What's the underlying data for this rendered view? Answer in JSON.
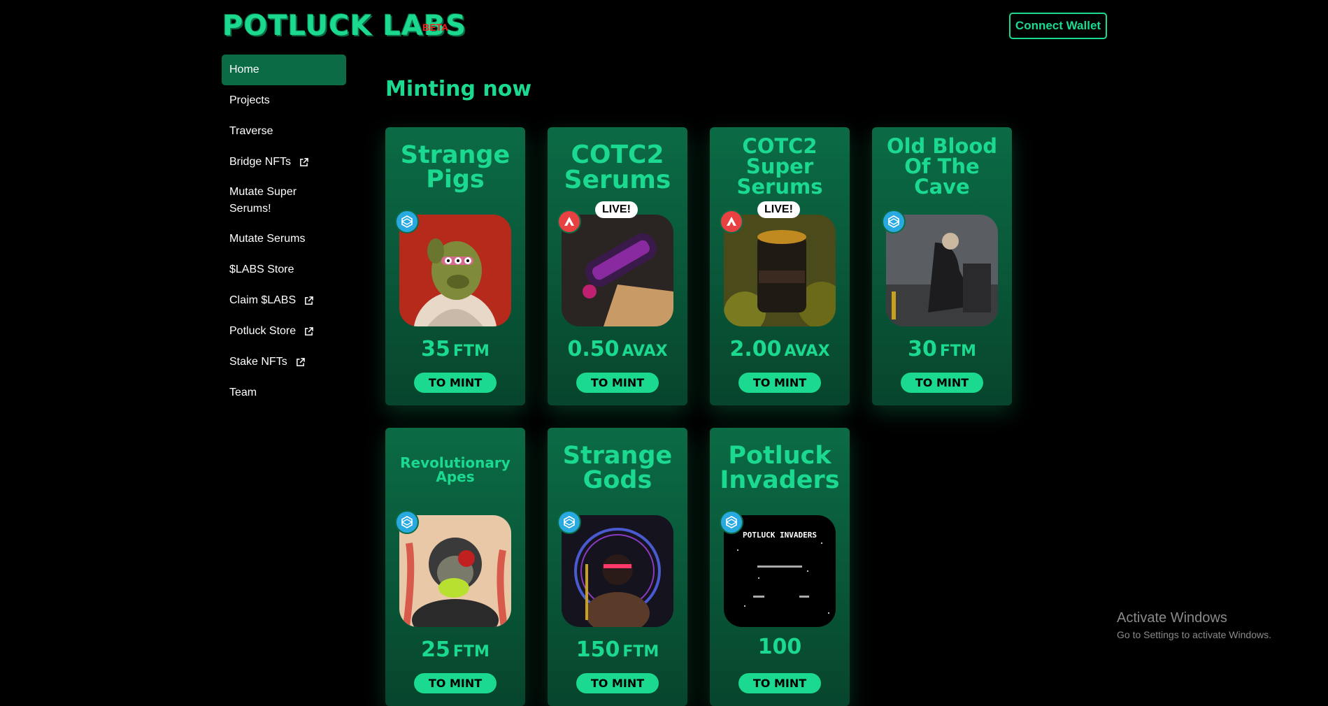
{
  "header": {
    "logo_text": "POTLUCK LABS",
    "beta_label": "BETA",
    "connect_wallet_label": "Connect Wallet"
  },
  "sidebar": {
    "items": [
      {
        "label": "Home",
        "active": true,
        "external": false
      },
      {
        "label": "Projects",
        "external": false
      },
      {
        "label": "Traverse",
        "external": false
      },
      {
        "label": "Bridge NFTs",
        "external": true
      },
      {
        "label": "Mutate Super Serums!",
        "external": false
      },
      {
        "label": "Mutate Serums",
        "external": false
      },
      {
        "label": "$LABS Store",
        "external": false
      },
      {
        "label": "Claim $LABS",
        "external": true
      },
      {
        "label": "Potluck Store",
        "external": true
      },
      {
        "label": "Stake NFTs",
        "external": true
      },
      {
        "label": "Team",
        "external": false
      }
    ]
  },
  "main": {
    "section_title": "Minting now",
    "cards": [
      {
        "title": "Strange Pigs",
        "chain": "fantom-icon",
        "live": false,
        "price": "35",
        "currency": "FTM",
        "button": "TO MINT"
      },
      {
        "title": "COTC2 Serums",
        "chain": "avalanche-icon",
        "live": true,
        "live_label": "LIVE!",
        "price": "0.50",
        "currency": "AVAX",
        "button": "TO MINT"
      },
      {
        "title": "COTC2 Super Serums",
        "chain": "avalanche-icon",
        "live": true,
        "live_label": "LIVE!",
        "price": "2.00",
        "currency": "AVAX",
        "button": "TO MINT"
      },
      {
        "title": "Old Blood Of The Cave",
        "chain": "fantom-icon",
        "live": false,
        "price": "30",
        "currency": "FTM",
        "button": "TO MINT"
      },
      {
        "title": "Revolutionary Apes",
        "chain": "fantom-icon",
        "live": false,
        "price": "25",
        "currency": "FTM",
        "button": "TO MINT"
      },
      {
        "title": "Strange Gods",
        "chain": "fantom-icon",
        "live": false,
        "price": "150",
        "currency": "FTM",
        "button": "TO MINT"
      },
      {
        "title": "Potluck Invaders",
        "chain": "fantom-icon",
        "live": false,
        "price": "100",
        "currency": "",
        "button": "TO MINT",
        "image_text": "POTLUCK INVADERS"
      }
    ]
  },
  "os_watermark": {
    "line1": "Activate Windows",
    "line2": "Go to Settings to activate Windows."
  },
  "colors": {
    "accent": "#1bd98f",
    "card_bg": "#0b6b45",
    "beta": "#ff1a1a",
    "fantom": "#28a9e0",
    "avalanche": "#e84142"
  }
}
